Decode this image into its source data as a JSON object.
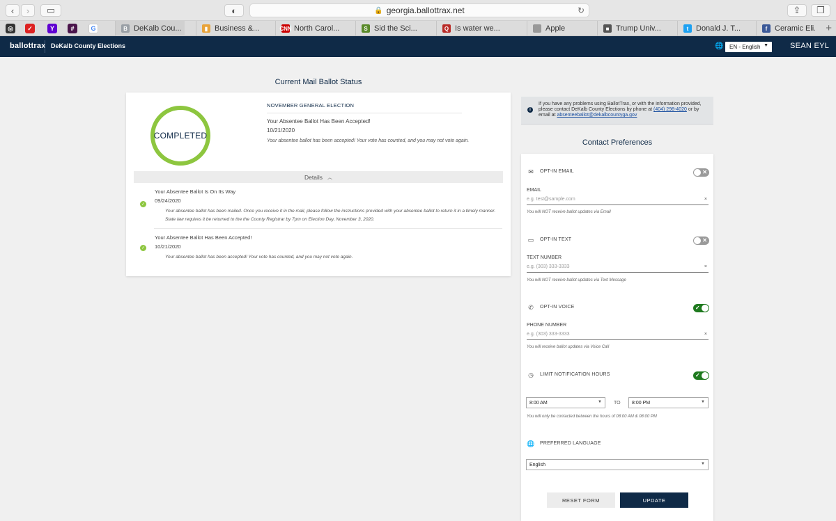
{
  "browser": {
    "url": "georgia.ballottrax.net",
    "tabs": [
      {
        "label": "DeKalb Cou...",
        "icon": "B",
        "color": "#9aa0a6",
        "active": true
      },
      {
        "label": "Business &...",
        "icon": "▮",
        "color": "#e8a33a"
      },
      {
        "label": "North Carol...",
        "icon": "CNN",
        "color": "#cc0000"
      },
      {
        "label": "Sid the Sci...",
        "icon": "S",
        "color": "#5a8a2a"
      },
      {
        "label": "Is water we...",
        "icon": "Q",
        "color": "#b92b27"
      },
      {
        "label": "Apple",
        "icon": "",
        "color": "#999999"
      },
      {
        "label": "Trump Univ...",
        "icon": "■",
        "color": "#555555"
      },
      {
        "label": "Donald J. T...",
        "icon": "t",
        "color": "#1da1f2"
      },
      {
        "label": "Ceramic Eli...",
        "icon": "f",
        "color": "#3b5998"
      }
    ]
  },
  "header": {
    "logo": "ballottrax",
    "county": "DeKalb County Elections",
    "language": "EN - English",
    "user": "SEAN EYL"
  },
  "status": {
    "title": "Current Mail Ballot Status",
    "badge": "COMPLETED",
    "election": "NOVEMBER GENERAL ELECTION",
    "headline": "Your Absentee Ballot Has Been Accepted!",
    "date": "10/21/2020",
    "message": "Your absentee ballot has been accepted! Your vote has counted, and you may not vote again.",
    "details_label": "Details",
    "history": [
      {
        "headline": "Your Absentee Ballot Is On Its Way",
        "date": "09/24/2020",
        "message": "Your absentee ballot has been mailed. Once you receive it in the mail, please follow the instructions provided with your absentee ballot to return it in a timely manner. State law requires it be returned to the the County Registrar by 7pm on Election Day, November 3, 2020."
      },
      {
        "headline": "Your Absentee Ballot Has Been Accepted!",
        "date": "10/21/2020",
        "message": "Your absentee ballot has been accepted! Your vote has counted, and you may not vote again."
      }
    ]
  },
  "info": {
    "text_before": "If you have any problems using BallotTrax, or with the information provided, please contact DeKalb County Elections by phone at",
    "phone": "(404) 298-4020",
    "text_middle": "or by email at",
    "email": "absenteeballot@dekalbcountyga.gov"
  },
  "prefs": {
    "title": "Contact Preferences",
    "email": {
      "toggle_label": "OPT-IN EMAIL",
      "enabled": false,
      "field_label": "EMAIL",
      "placeholder": "e.g. test@sample.com",
      "hint": "You will NOT receive ballot updates via Email"
    },
    "text": {
      "toggle_label": "OPT-IN TEXT",
      "enabled": false,
      "field_label": "TEXT NUMBER",
      "placeholder": "e.g. (303) 333-3333",
      "hint": "You will NOT receive ballot updates via Text Message"
    },
    "voice": {
      "toggle_label": "OPT-IN VOICE",
      "enabled": true,
      "field_label": "PHONE NUMBER",
      "placeholder": "e.g. (303) 333-3333",
      "hint": "You will receive ballot updates via Voice Call"
    },
    "hours": {
      "toggle_label": "LIMIT NOTIFICATION HOURS",
      "enabled": true,
      "from": "8:00 AM",
      "to_label": "TO",
      "to": "8:00 PM",
      "hint": "You will only be contacted between the hours of 08:00 AM & 08:00 PM"
    },
    "language": {
      "label": "PREFERRED LANGUAGE",
      "value": "English"
    },
    "reset_label": "RESET FORM",
    "update_label": "UPDATE"
  },
  "colors": {
    "navy": "#0f2a47",
    "green": "#8dc63f",
    "toggle_on": "#1f7a1f"
  }
}
